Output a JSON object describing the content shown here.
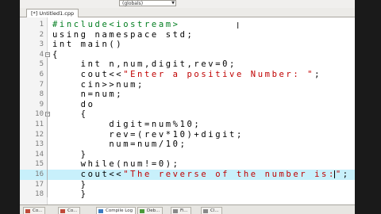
{
  "toolbar": {
    "scope": "(globals)"
  },
  "tab": {
    "file": "[*] Untitled1.cpp"
  },
  "lines": [
    {
      "n": "1",
      "html": "<span class=\"pp\">#include&lt;iostream&gt;</span>"
    },
    {
      "n": "2",
      "html": "using namespace std;"
    },
    {
      "n": "3",
      "html": "int main()"
    },
    {
      "n": "4",
      "html": "{"
    },
    {
      "n": "5",
      "html": "    int n,num,digit,rev=0;"
    },
    {
      "n": "6",
      "html": "    cout&lt;&lt;<span class=\"str\">\"Enter a positive Number: \"</span>;"
    },
    {
      "n": "7",
      "html": "    cin&gt;&gt;num;"
    },
    {
      "n": "8",
      "html": "    n=num;"
    },
    {
      "n": "9",
      "html": "    do"
    },
    {
      "n": "10",
      "html": "    {"
    },
    {
      "n": "11",
      "html": "        digit=num%10;"
    },
    {
      "n": "12",
      "html": "        rev=(rev*10)+digit;"
    },
    {
      "n": "13",
      "html": "        num=num/10;"
    },
    {
      "n": "14",
      "html": "    }"
    },
    {
      "n": "15",
      "html": "    while(num!=0);"
    },
    {
      "n": "16",
      "html": "    cout&lt;&lt;<span class=\"str\">\"The reverse of the number is:\"</span>;"
    },
    {
      "n": "17",
      "html": "    }"
    },
    {
      "n": "18",
      "html": "    }"
    }
  ],
  "bottom_tabs": [
    "Co...",
    "Co...",
    "Compile Log",
    "Deb...",
    "Fi...",
    "Cl..."
  ],
  "colors": {
    "string": "#c00000",
    "preprocessor": "#007d1f",
    "highlight": "#c8f0fb"
  }
}
